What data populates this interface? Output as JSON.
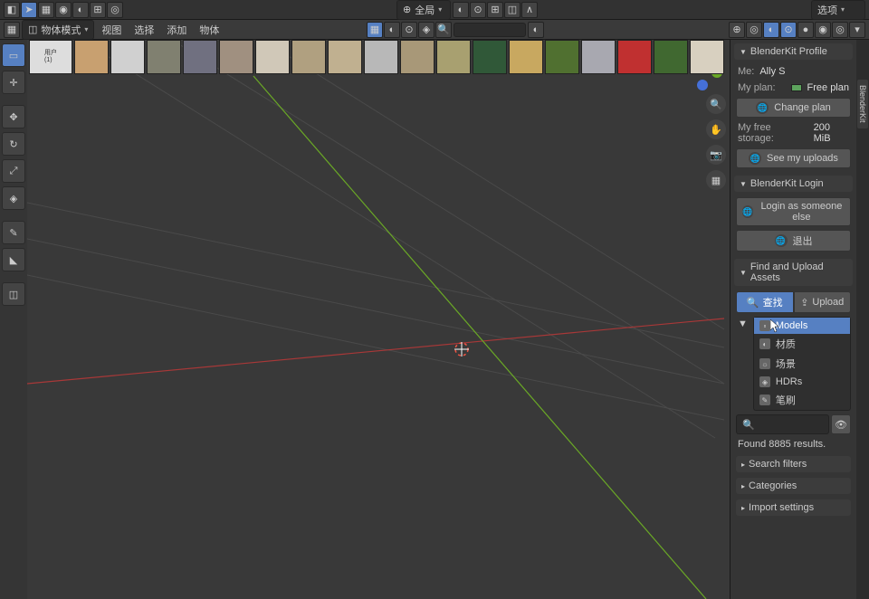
{
  "top_toolbar": {
    "options_label": "选项",
    "global_label": "全局"
  },
  "mode_bar": {
    "mode": "物体模式",
    "menu_view": "视图",
    "menu_select": "选择",
    "menu_add": "添加",
    "menu_object": "物体"
  },
  "left_tools": [
    {
      "name": "select-box",
      "active": true
    },
    {
      "name": "cursor"
    },
    {
      "name": "move"
    },
    {
      "name": "rotate"
    },
    {
      "name": "scale"
    },
    {
      "name": "transform"
    },
    {
      "name": "annotate"
    },
    {
      "name": "measure"
    },
    {
      "name": "add-cube"
    }
  ],
  "asset_strip": [
    {
      "label": "用户\\n(1)"
    },
    {
      "color": "#c8a070"
    },
    {
      "color": "#d0d0d0"
    },
    {
      "color": "#808070"
    },
    {
      "color": "#707080"
    },
    {
      "color": "#a09080"
    },
    {
      "color": "#d0c8b8"
    },
    {
      "color": "#b0a080"
    },
    {
      "color": "#c0b090"
    },
    {
      "color": "#b8b8b8"
    },
    {
      "color": "#a89878"
    },
    {
      "color": "#a8a070"
    },
    {
      "color": "#305838"
    },
    {
      "color": "#c8a860"
    },
    {
      "color": "#507030"
    },
    {
      "color": "#a8a8b0"
    },
    {
      "color": "#c03030"
    },
    {
      "color": "#406830"
    },
    {
      "color": "#d8d0c0"
    }
  ],
  "sidebar": {
    "profile": {
      "title": "BlenderKit Profile",
      "me_label": "Me:",
      "me_val": "Ally S",
      "plan_label": "My plan:",
      "plan_val": "Free plan",
      "change_plan": "Change plan",
      "storage_label": "My free storage:",
      "storage_val": "200 MiB",
      "see_uploads": "See my uploads"
    },
    "login": {
      "title": "BlenderKit Login",
      "as_someone": "Login as someone else",
      "logout": "退出"
    },
    "find": {
      "title": "Find and Upload Assets",
      "search_tab": "查找",
      "upload_tab": "Upload",
      "types": [
        {
          "icon": "▫",
          "label": "Models",
          "active": true
        },
        {
          "icon": "◐",
          "label": "材质"
        },
        {
          "icon": "☼",
          "label": "场景"
        },
        {
          "icon": "◈",
          "label": "HDRs"
        },
        {
          "icon": "✎",
          "label": "笔刷"
        }
      ],
      "results": "Found 8885 results.",
      "filters": "Search filters",
      "categories": "Categories",
      "import": "Import settings"
    }
  },
  "vtab_label": "BlenderKit"
}
